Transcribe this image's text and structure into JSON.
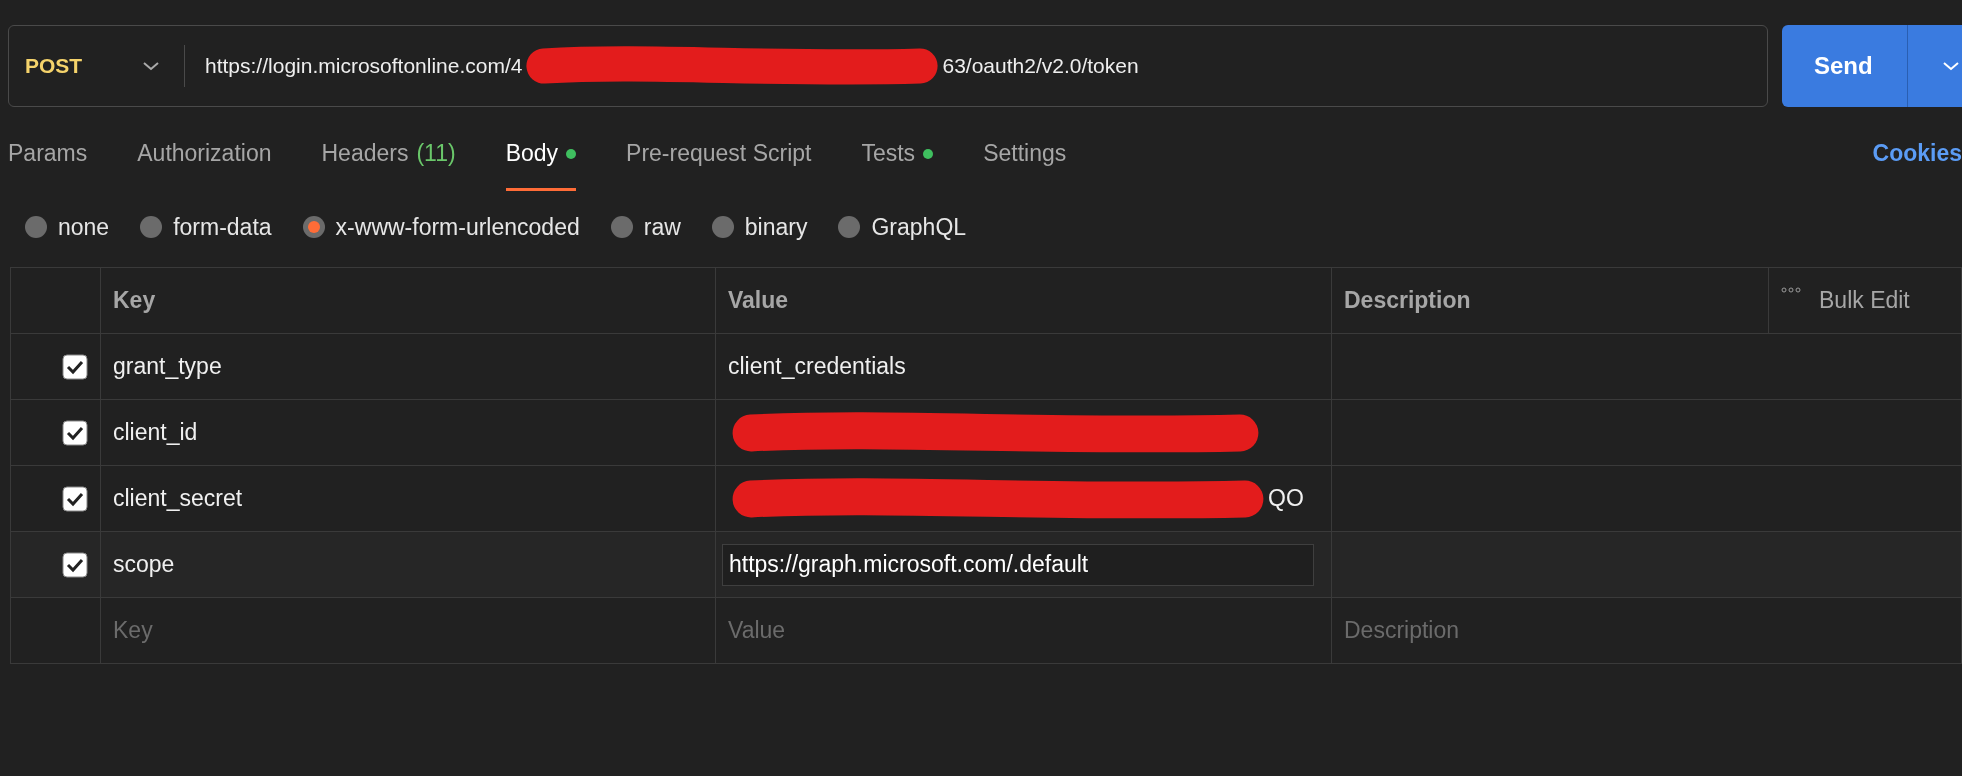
{
  "request": {
    "method": "POST",
    "url_before": "https://login.microsoftonline.com/4",
    "redacted": true,
    "url_after": "63/oauth2/v2.0/token",
    "send_label": "Send"
  },
  "tabs": [
    {
      "label": "Params",
      "selected": false,
      "dot": false
    },
    {
      "label": "Authorization",
      "selected": false,
      "dot": false
    },
    {
      "label": "Headers",
      "count": "(11)",
      "selected": false,
      "dot": false
    },
    {
      "label": "Body",
      "selected": true,
      "dot": true
    },
    {
      "label": "Pre-request Script",
      "selected": false,
      "dot": false
    },
    {
      "label": "Tests",
      "selected": false,
      "dot": true
    },
    {
      "label": "Settings",
      "selected": false,
      "dot": false
    }
  ],
  "cookies_link": "Cookies",
  "body_types": [
    {
      "label": "none",
      "selected": false
    },
    {
      "label": "form-data",
      "selected": false
    },
    {
      "label": "x-www-form-urlencoded",
      "selected": true
    },
    {
      "label": "raw",
      "selected": false
    },
    {
      "label": "binary",
      "selected": false
    },
    {
      "label": "GraphQL",
      "selected": false
    }
  ],
  "table": {
    "columns": [
      "Key",
      "Value",
      "Description"
    ],
    "bulk_edit": "Bulk Edit",
    "rows": [
      {
        "checked": true,
        "key": "grant_type",
        "value": "client_credentials",
        "redacted": false,
        "editing": false
      },
      {
        "checked": true,
        "key": "client_id",
        "redacted": true,
        "editing": false
      },
      {
        "checked": true,
        "key": "client_secret",
        "value": "QO",
        "redacted": true,
        "editing": false
      },
      {
        "checked": true,
        "key": "scope",
        "value": "https://graph.microsoft.com/.default",
        "redacted": false,
        "editing": true
      }
    ],
    "new_row": {
      "key": {
        "placeholder": "Key"
      },
      "value": {
        "placeholder": "Value"
      },
      "description": {
        "placeholder": "Description"
      }
    }
  }
}
